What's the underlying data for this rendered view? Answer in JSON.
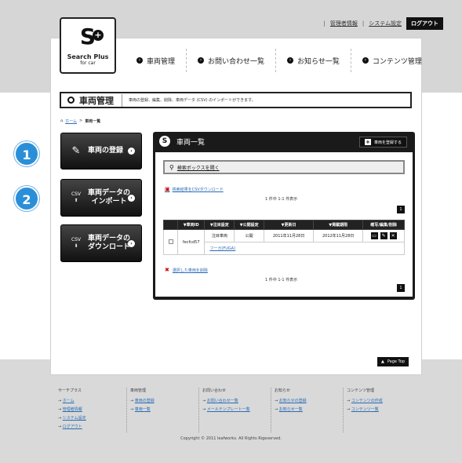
{
  "header": {
    "utility_links": [
      "管理者情報",
      "システム設定"
    ],
    "logout_label": "ログアウト",
    "logo_title": "Search Plus",
    "logo_subtitle": "for car",
    "nav": [
      {
        "label": "車両管理",
        "icon": "arrow-right-circle-icon"
      },
      {
        "label": "お問い合わせ一覧",
        "icon": "arrow-right-circle-icon"
      },
      {
        "label": "お知らせ一覧",
        "icon": "arrow-right-circle-icon"
      },
      {
        "label": "コンテンツ管理",
        "icon": "arrow-right-circle-icon"
      }
    ]
  },
  "page": {
    "title": "車両管理",
    "description": "車両の登録、編集、削除、車両データ (CSV) のインポートができます。",
    "breadcrumb_home": "ホーム",
    "breadcrumb_sep": ">",
    "breadcrumb_current": "車両一覧"
  },
  "steps": [
    "1",
    "2"
  ],
  "side_buttons": [
    {
      "label1": "車両の登録",
      "label2": "",
      "icon": "edit-icon"
    },
    {
      "label1": "車両データの",
      "label2": "インポート",
      "icon": "csv-import-icon",
      "icon_text": "CSV"
    },
    {
      "label1": "車両データの",
      "label2": "ダウンロード",
      "icon": "csv-download-icon",
      "icon_text": "CSV"
    }
  ],
  "panel": {
    "title": "車両一覧",
    "register_label": "車両を登録する",
    "search_label": "検索ボックスを開く",
    "csv_download_label": "検索結果をCSVダウンロード",
    "count_text": "1 件中 1-1 件表示",
    "pager_label": "1",
    "delete_selected_label": "選択した車両を削除"
  },
  "table": {
    "headers": [
      "▼車両ID",
      "▼注目設定",
      "▼公開設定",
      "▼更新日",
      "▼掲載期限",
      "確写/編集/削除"
    ],
    "rows": [
      {
        "id": "fecfcd57",
        "featured": "注目車両",
        "status": "公開",
        "updated": "2011年11月28日",
        "expiry": "2012年11月28日",
        "name_link": "フーガ(FUGA)"
      }
    ]
  },
  "page_top_label": "Page Top",
  "footer": {
    "columns": [
      {
        "heading": "サーチプラス",
        "items": [
          "ホーム",
          "管理者情報",
          "システム設定",
          "ログアウト"
        ]
      },
      {
        "heading": "車両管理",
        "items": [
          "車両の登録",
          "車両一覧"
        ]
      },
      {
        "heading": "お問い合わせ",
        "items": [
          "お問い合わせ一覧",
          "メールテンプレート一覧"
        ]
      },
      {
        "heading": "お知らせ",
        "items": [
          "お知らせの登録",
          "お知らせ一覧"
        ]
      },
      {
        "heading": "コンテンツ管理",
        "items": [
          "コンテンツの作成",
          "コンテンツ一覧"
        ]
      }
    ],
    "copyright": "Copyright © 2011 leafworks. All Rights Rigeserved."
  },
  "colors": {
    "accent_blue": "#2b8fd8",
    "dark": "#111111",
    "link": "#2a6db5"
  }
}
